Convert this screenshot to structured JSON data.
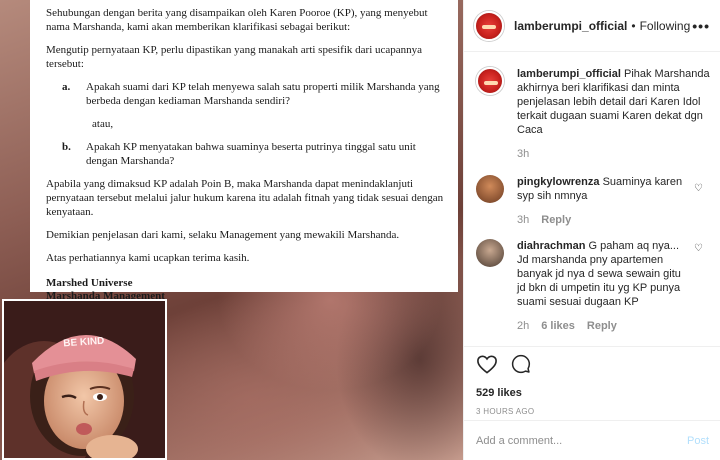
{
  "document": {
    "para1": "Sehubungan dengan berita yang disampaikan oleh Karen Pooroe (KP), yang menyebut nama Marshanda, kami akan memberikan klarifikasi sebagai berikut:",
    "para2": "Mengutip pernyataan KP, perlu dipastikan yang manakah arti spesifik dari ucapannya tersebut:",
    "q_a_label": "a.",
    "q_a_text": "Apakah suami dari KP telah menyewa salah satu properti milik Marshanda yang berbeda dengan kediaman Marshanda sendiri?",
    "atau": "atau,",
    "q_b_label": "b.",
    "q_b_text": "Apakah KP menyatakan bahwa suaminya beserta putrinya tinggal satu unit dengan Marshanda?",
    "para3": "Apabila yang dimaksud KP adalah Poin B, maka Marshanda dapat menindaklanjuti pernyataan tersebut melalui jalur hukum karena itu adalah fitnah yang tidak sesuai dengan kenyataan.",
    "para4": "Demikian penjelasan dari kami, selaku Management yang mewakili Marshanda.",
    "para5": "Atas perhatiannya kami ucapkan terima kasih.",
    "sig1": "Marshed Universe",
    "sig2": "Marshanda Management"
  },
  "photo": {
    "cap_text": "BE KIND"
  },
  "header": {
    "username": "lamberumpi_official",
    "separator": "•",
    "follow_status": "Following",
    "more_icon": "more-dots-icon"
  },
  "caption": {
    "username": "lamberumpi_official",
    "text": "Pihak Marshanda akhirnya beri klarifikasi dan minta penjelasan lebih detail dari Karen Idol terkait dugaan suami Karen dekat dgn Caca",
    "time": "3h"
  },
  "comments": [
    {
      "username": "pingkylowrenza",
      "text": "Suaminya karen syp sih nmnya",
      "time": "3h",
      "likes": "",
      "reply": "Reply"
    },
    {
      "username": "diahrachman",
      "text": "G paham aq nya... Jd marshanda pny apartemen banyak jd nya d sewa sewain gitu jd bkn di umpetin itu yg KP punya suami sesuai dugaan KP",
      "time": "2h",
      "likes": "6 likes",
      "reply": "Reply"
    }
  ],
  "actions": {
    "likes": "529 likes",
    "timestamp": "3 HOURS AGO"
  },
  "add_comment": {
    "placeholder": "Add a comment...",
    "post_label": "Post"
  },
  "colors": {
    "text": "#262626",
    "muted": "#8e8e8e",
    "post_disabled": "#b2dffc",
    "avatar_red": "#c9221e"
  }
}
